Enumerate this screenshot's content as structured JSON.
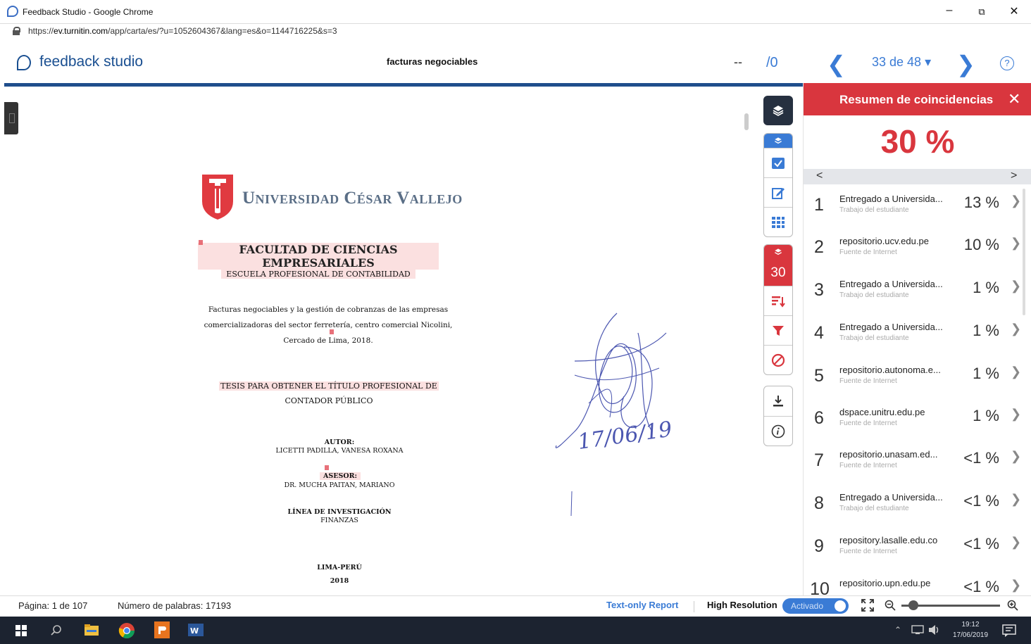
{
  "window": {
    "title": "Feedback Studio - Google Chrome",
    "url_prefix": "https://",
    "url_host": "ev.turnitin.com",
    "url_path": "/app/carta/es/?u=1052604367&lang=es&o=1144716225&s=3"
  },
  "header": {
    "logo": "feedback studio",
    "document_title": "facturas negociables",
    "score_dash": "--",
    "score_total": "/0",
    "paper_selector": "33 de 48 ▾",
    "help": "?"
  },
  "document": {
    "university": "Universidad César Vallejo",
    "faculty": "FACULTAD DE CIENCIAS EMPRESARIALES",
    "school": "ESCUELA PROFESIONAL DE CONTABILIDAD",
    "title_line1": "Facturas negociables y la gestión de cobranzas de las empresas",
    "title_line2": "comercializadoras del sector ferretería, centro comercial Nicolini,",
    "title_line3": "Cercado de Lima, 2018.",
    "thesis_line1": "TESIS PARA OBTENER EL TÍTULO PROFESIONAL DE",
    "thesis_line2": "CONTADOR PÚBLICO",
    "author_label": "AUTOR:",
    "author_name": "LICETTI PADILLA, VANESA ROXANA",
    "advisor_label": "ASESOR:",
    "advisor_name": "DR. MUCHA PAITAN, MARIANO",
    "line_label": "LÍNEA DE INVESTIGACIÓN",
    "line_value": "FINANZAS",
    "place": "LIMA-PERÚ",
    "year": "2018",
    "signature_date": "17/06/19"
  },
  "toolbar": {
    "similarity_badge": "30"
  },
  "panel": {
    "title": "Resumen de coincidencias",
    "close": "✕",
    "overall": "30 %",
    "pager_prev": "<",
    "pager_next": ">",
    "matches": [
      {
        "n": "1",
        "source": "Entregado a Universida...",
        "type": "Trabajo del estudiante",
        "pct": "13 %"
      },
      {
        "n": "2",
        "source": "repositorio.ucv.edu.pe",
        "type": "Fuente de Internet",
        "pct": "10 %"
      },
      {
        "n": "3",
        "source": "Entregado a Universida...",
        "type": "Trabajo del estudiante",
        "pct": "1 %"
      },
      {
        "n": "4",
        "source": "Entregado a Universida...",
        "type": "Trabajo del estudiante",
        "pct": "1 %"
      },
      {
        "n": "5",
        "source": "repositorio.autonoma.e...",
        "type": "Fuente de Internet",
        "pct": "1 %"
      },
      {
        "n": "6",
        "source": "dspace.unitru.edu.pe",
        "type": "Fuente de Internet",
        "pct": "1 %"
      },
      {
        "n": "7",
        "source": "repositorio.unasam.ed...",
        "type": "Fuente de Internet",
        "pct": "<1 %"
      },
      {
        "n": "8",
        "source": "Entregado a Universida...",
        "type": "Trabajo del estudiante",
        "pct": "<1 %"
      },
      {
        "n": "9",
        "source": "repository.lasalle.edu.co",
        "type": "Fuente de Internet",
        "pct": "<1 %"
      },
      {
        "n": "10",
        "source": "repositorio.upn.edu.pe",
        "type": "",
        "pct": "<1 %"
      }
    ]
  },
  "status": {
    "page": "Página: 1 de 107",
    "words": "Número de palabras: 17193",
    "text_only": "Text-only Report",
    "high_res": "High Resolution",
    "toggle": "Activado"
  },
  "taskbar": {
    "time": "19:12",
    "date": "17/06/2019"
  },
  "colors": {
    "brand_blue": "#1a4f91",
    "link_blue": "#3a7bd5",
    "match_red": "#d9363e"
  }
}
